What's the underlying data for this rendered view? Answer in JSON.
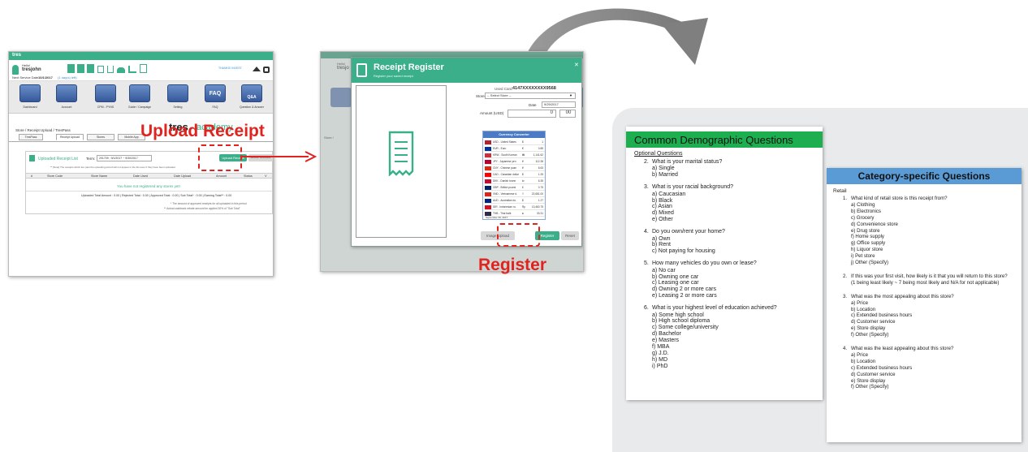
{
  "dashboard": {
    "logo": "tres",
    "user_greeting": "Hello!",
    "username": "tresjohn",
    "service_date_label": "Next Service Date",
    "service_date_value": "10/1/2017",
    "service_date_note": "(1 day(s) left)",
    "thanks_badge": "THANKS! INVEST",
    "nav_icons": [
      "Dashboard",
      "Account",
      "CPM - PYNS",
      "Guide / Campaign",
      "Setting",
      "FAQ",
      "Question & Answer"
    ],
    "faq_icon_text": "FAQ",
    "qa_icon_text": "Q&A",
    "breadcrumb": "Store / Receipt Upload / TresPass",
    "tabs": [
      "TresPass",
      "Receipt Upload",
      "Stores",
      "Mobile App"
    ],
    "academy_logo_a": "tres",
    "academy_logo_b": "academy",
    "card_title": "Uploaded Receipt List",
    "term_label": "Term:",
    "term_value": "201709 : 9/1/2017 ~ 9/30/2017",
    "upload_button": "Upload Receipt",
    "delete_button": "Delete Selected",
    "notice": "** [Note] The receipts which are past the uploading period will not appear in the list even if they have been uploaded",
    "columns": [
      "#",
      "Store Code",
      "Store Name",
      "Date Used",
      "Date Upload",
      "Amount",
      "Status",
      "V"
    ],
    "empty_message": "You have not registered any stores yet!",
    "totals_line": "Uploaded Total Amount : 0.00  |  Rejected Total : 0.00  |  Approved Total : 0.00  |  Sub Total* : 0.00  |  Earning Total** : 0.00",
    "footnote_1": "* The amount of approved receipts for all uploaded in this period",
    "footnote_2": "** Actual cashback rebate amount be applied 30% of \"Sub Total\""
  },
  "label_upload": "Upload Receipt",
  "label_register": "Register",
  "register_modal": {
    "bg_greeting": "Hello!",
    "bg_username": "tresjo",
    "title": "Receipt Register",
    "subtitle": "Register your saved receipt",
    "used_card_label": "Used Card:",
    "used_card_value": "4147XXXXXXXX9568",
    "store_label": "Store",
    "store_placeholder": "-- Select Store --",
    "date_label": "Date",
    "date_value": "9/29/2017",
    "amount_label": "Amount (USD)",
    "amount_value_1": "0",
    "amount_value_2": "00",
    "converter_title": "Currency Converter",
    "converter_rows": [
      {
        "currency": "USD - United States",
        "symbol": "$",
        "value": "1"
      },
      {
        "currency": "EUR - Euro",
        "symbol": "€",
        "value": "0.85"
      },
      {
        "currency": "KRW - South Korean",
        "symbol": "₩",
        "value": "1,141.62"
      },
      {
        "currency": "JPY - Japanese yen",
        "symbol": "¥",
        "value": "112.28"
      },
      {
        "currency": "CNY - Chinese yuan",
        "symbol": "¥",
        "value": "6.63"
      },
      {
        "currency": "CAD - Canadian dollar",
        "symbol": "$",
        "value": "1.25"
      },
      {
        "currency": "DKK - Danish krone",
        "symbol": "kr",
        "value": "6.35"
      },
      {
        "currency": "GBP - British pound",
        "symbol": "£",
        "value": "0.75"
      },
      {
        "currency": "VND - Vietnamese d.",
        "symbol": "₫",
        "value": "22,681.00"
      },
      {
        "currency": "AUD - Australian do.",
        "symbol": "$",
        "value": "1.27"
      },
      {
        "currency": "IDR - Indonesian ru.",
        "symbol": "Rp",
        "value": "13,460.75"
      },
      {
        "currency": "THB - Thai baht",
        "symbol": "฿",
        "value": "33.31"
      }
    ],
    "converter_date": "September 29, 2017",
    "image_upload_button": "Image Upload",
    "register_button": "Register",
    "reset_button": "Reset",
    "bg_breadcrumb": "Store /",
    "bg_fragment": "nu"
  },
  "demographic": {
    "title": "Common Demographic Questions",
    "intro": "Optional Questions",
    "questions": [
      {
        "num": "2.",
        "text": "What is your marital status?",
        "options": [
          "a)  Single",
          "b)  Married"
        ]
      },
      {
        "num": "3.",
        "text": "What is your racial background?",
        "options": [
          "a)  Caucasian",
          "b)  Black",
          "c)  Asian",
          "d)  Mixed",
          "e)  Other"
        ]
      },
      {
        "num": "4.",
        "text": "Do you own/rent your home?",
        "options": [
          "a)  Own",
          "b)  Rent",
          "c)  Not paying for housing"
        ]
      },
      {
        "num": "5.",
        "text": "How many vehicles do you own or lease?",
        "options": [
          "a)  No car",
          "b)  Owning one car",
          "c)  Leasing one car",
          "d)  Owning 2 or more cars",
          "e)  Leasing 2 or more cars"
        ]
      },
      {
        "num": "6.",
        "text": "What is your highest level of education achieved?",
        "options": [
          "a)  Some high school",
          "b)  High school diploma",
          "c)  Some college/university",
          "d)  Bachelor",
          "e)  Masters",
          "f)  MBA",
          "g)  J.D.",
          "h)  MD",
          "i)  PhD"
        ]
      }
    ]
  },
  "category": {
    "title": "Category-specific Questions",
    "section": "Retail",
    "questions": [
      {
        "num": "1.",
        "text": "What kind of retail store is this receipt from?",
        "options": [
          "a)  Clothing",
          "b)  Electronics",
          "c)  Grocery",
          "d)  Convenience store",
          "e)  Drug store",
          "f)  Home supply",
          "g)  Office supply",
          "h)  Liquor store",
          "i)  Pet store",
          "j)  Other (Specify)"
        ]
      },
      {
        "num": "2.",
        "text": "If this was your first visit, how likely is it that you will return to this store?",
        "options": [
          "(1 being least likely ~ 7 being most likely and N/A for not applicable)"
        ]
      },
      {
        "num": "3.",
        "text": "What was the most appealing about this store?",
        "options": [
          "a)  Price",
          "b)  Location",
          "c)  Extended business hours",
          "d)  Customer service",
          "e)  Store display",
          "f)  Other (Specify)"
        ]
      },
      {
        "num": "4.",
        "text": "What was the least appealing about this store?",
        "options": [
          "a)  Price",
          "b)  Location",
          "c)  Extended business hours",
          "d)  Customer service",
          "e)  Store display",
          "f)  Other (Specify)"
        ]
      }
    ]
  },
  "colors": {
    "accent_red": "#e0231e",
    "brand_green": "#3aaf8a",
    "demographic_header": "#1dae50",
    "category_header": "#5b9bd5",
    "arrow_grey": "#8c8c8c"
  }
}
